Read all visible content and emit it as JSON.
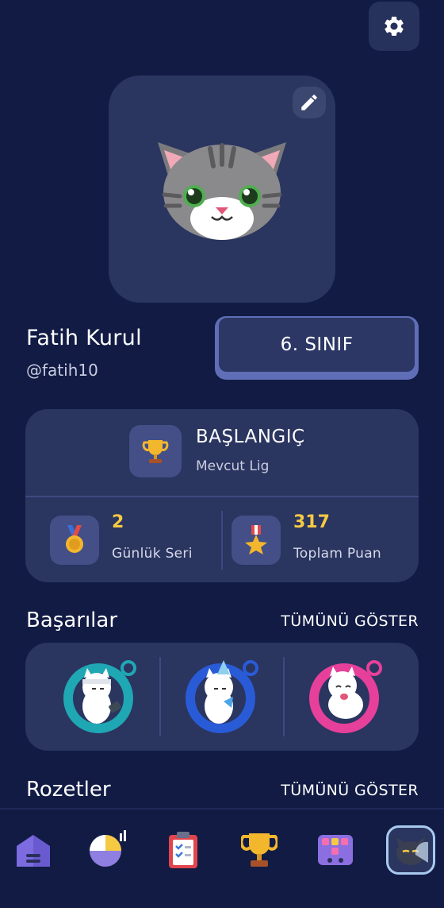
{
  "profile": {
    "name": "Fatih Kurul",
    "handle": "@fatih10",
    "grade": "6. SINIF"
  },
  "league": {
    "name": "BAŞLANGIÇ",
    "subtitle": "Mevcut Lig"
  },
  "stats": [
    {
      "value": "2",
      "label": "Günlük Seri",
      "icon": "medal-icon"
    },
    {
      "value": "317",
      "label": "Toplam Puan",
      "icon": "star-medal-icon"
    }
  ],
  "achievements": {
    "title": "Başarılar",
    "show_all": "TÜMÜNÜ GÖSTER",
    "badges": [
      {
        "icon": "cat-headband-badge-icon",
        "color": "#1fa7b4"
      },
      {
        "icon": "cat-party-badge-icon",
        "color": "#2a5bd7"
      },
      {
        "icon": "cat-pink-badge-icon",
        "color": "#e6409a"
      }
    ]
  },
  "badges_section": {
    "title": "Rozetler",
    "show_all": "TÜMÜNÜ GÖSTER"
  },
  "nav": [
    {
      "name": "nav-home",
      "icon": "home-icon"
    },
    {
      "name": "nav-stats",
      "icon": "pie-chart-icon"
    },
    {
      "name": "nav-tasks",
      "icon": "clipboard-icon"
    },
    {
      "name": "nav-leaderboard",
      "icon": "trophy-icon"
    },
    {
      "name": "nav-games",
      "icon": "game-board-icon"
    },
    {
      "name": "nav-profile",
      "icon": "cat-avatar-icon",
      "active": true
    }
  ],
  "colors": {
    "background": "#111b44",
    "card": "#2a3560",
    "accent_gold": "#f6c943",
    "grade_border": "#5f6eb6"
  }
}
